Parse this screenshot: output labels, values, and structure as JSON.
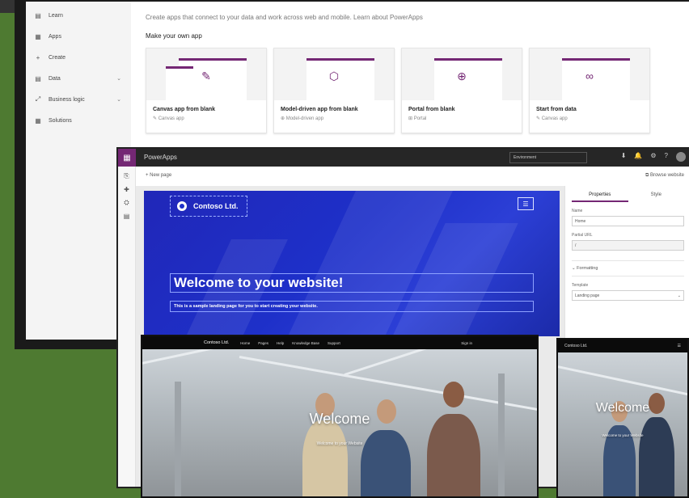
{
  "home": {
    "intro": "Create apps that connect to your data and work across web and mobile. Learn about PowerApps",
    "make_heading": "Make your own app",
    "nav": [
      {
        "icon": "learn-icon",
        "glyph": "▤",
        "label": "Learn",
        "chevron": ""
      },
      {
        "icon": "apps-icon",
        "glyph": "▦",
        "label": "Apps",
        "chevron": ""
      },
      {
        "icon": "plus-icon",
        "glyph": "+",
        "label": "Create",
        "chevron": ""
      },
      {
        "icon": "data-icon",
        "glyph": "▤",
        "label": "Data",
        "chevron": "⌄"
      },
      {
        "icon": "business-logic-icon",
        "glyph": "⤢",
        "label": "Business logic",
        "chevron": "⌄"
      },
      {
        "icon": "solutions-icon",
        "glyph": "▦",
        "label": "Solutions",
        "chevron": ""
      }
    ],
    "cards": [
      {
        "title": "Canvas app from blank",
        "sub": "Canvas app",
        "sub_icon": "✎",
        "symbol": "✎"
      },
      {
        "title": "Model-driven app from blank",
        "sub": "Model-driven app",
        "sub_icon": "⊕",
        "symbol": "⬡"
      },
      {
        "title": "Portal from blank",
        "sub": "Portal",
        "sub_icon": "⊞",
        "symbol": "⊕"
      },
      {
        "title": "Start from data",
        "sub": "Canvas app",
        "sub_icon": "✎",
        "symbol": "∞"
      }
    ]
  },
  "designer": {
    "app_name": "PowerApps",
    "environment": "Environment",
    "new_page": "+ New page",
    "browse": "Browse website",
    "hero": {
      "brand": "Contoso Ltd.",
      "heading": "Welcome to your website!",
      "subtext": "This is a sample landing page for you to start creating your website."
    },
    "properties": {
      "tabs": [
        "Properties",
        "Style"
      ],
      "name_label": "Name",
      "name_value": "Home",
      "partial_url_label": "Partial URL",
      "partial_url_value": "/",
      "formatting_label": "Formatting",
      "template_label": "Template",
      "template_value": "Landing page"
    }
  },
  "preview": {
    "nav": {
      "brand": "Contoso Ltd.",
      "items": [
        "Home",
        "Pages",
        "Help",
        "Knowledge Base",
        "Support"
      ],
      "signin": "Sign in"
    },
    "welcome": "Welcome",
    "subtitle": "Welcome to your Website",
    "mobile_brand": "Contoso Ltd."
  }
}
